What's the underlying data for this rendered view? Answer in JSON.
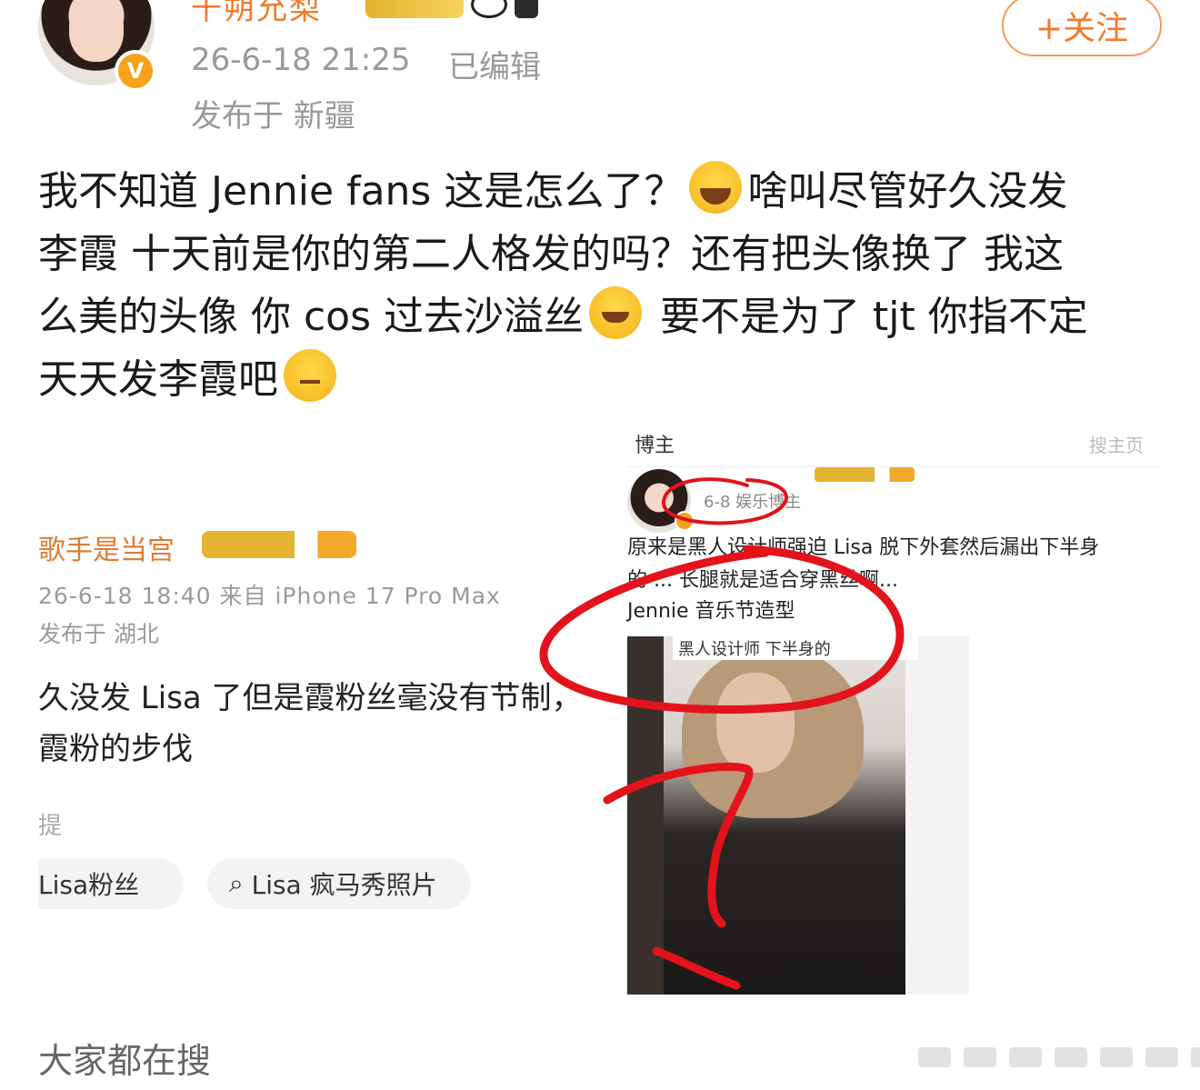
{
  "header": {
    "username": "千朔允梨",
    "timestamp": "26-6-18 21:25",
    "edited_label": "已编辑",
    "location": "发布于 新疆",
    "follow_label": "+关注",
    "verified_badge": "V"
  },
  "post": {
    "line1_a": "我不知道 Jennie fans 这是怎么了？",
    "line1_b": "啥叫尽管好久没发",
    "line2": "李霞 十天前是你的第二人格发的吗？还有把头像换了 我这",
    "line3_a": "么美的头像 你 cos 过去沙溢丝",
    "line3_b": "要不是为了 tjt 你指不定",
    "line4": "天天发李霞吧",
    "emojis": [
      "crying-face-icon",
      "grinning-face-icon",
      "thinking-face-icon"
    ]
  },
  "embedded_left": {
    "name": "歌手是当宫",
    "time": "26-6-18 18:40  来自 iPhone 17 Pro Max",
    "location": "发布于 湖北",
    "body1": "久没发 Lisa 了但是霞粉丝毫没有节制，",
    "body2": "霞粉的步伐",
    "mark": "提",
    "pills": [
      "Lisa粉丝",
      "Lisa 疯马秀照片"
    ]
  },
  "embedded_right": {
    "tab": "博主",
    "search": "搜主页",
    "date": "6-8  娱乐博主",
    "text1": "原来是黑人设计师强迫 Lisa 脱下外套然后漏出下半身",
    "text2": "的 ... 长腿就是适合穿黑丝啊...",
    "text3": "Jennie 音乐节造型",
    "photo_caption": "黑人设计师 下半身的"
  },
  "footer": {
    "label": "大家都在搜"
  },
  "colors": {
    "accent": "#f27a2a",
    "annotation_red": "#e3131b",
    "meta_gray": "#999999"
  }
}
